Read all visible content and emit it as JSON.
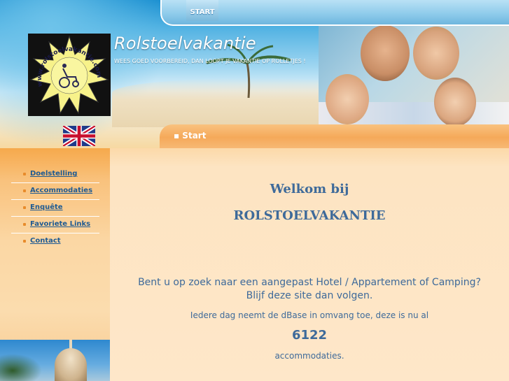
{
  "topnav": {
    "tabs": [
      {
        "label": "START"
      }
    ]
  },
  "header": {
    "logo_text": "www.rolstoelvakantie.com",
    "site_title": "Rolstoelvakantie",
    "tagline": "WEES GOED VOORBEREID, DAN LOOPT JE VAKANTIE OP ROLLETJES !",
    "language_flag": "uk-flag-icon"
  },
  "breadcrumb": {
    "label": "▪ Start"
  },
  "sidebar": {
    "items": [
      {
        "label": "Doelstelling"
      },
      {
        "label": "Accommodaties"
      },
      {
        "label": "Enquête"
      },
      {
        "label": "Favoriete Links"
      },
      {
        "label": "Contact"
      }
    ]
  },
  "main": {
    "welcome": "Welkom bij",
    "site_name": "ROLSTOELVAKANTIE",
    "intro_line1": "Bent u op zoek naar een aangepast Hotel / Appartement of Camping?",
    "intro_line2": "Blijf deze site dan volgen.",
    "growth_text": "Iedere dag neemt de dBase in omvang toe, deze is nu al",
    "count": "6122",
    "count_unit": "accommodaties."
  },
  "colors": {
    "link": "#1e5a92",
    "heading": "#3e6a9a",
    "accent_orange": "#f5a95a",
    "sky_blue": "#8ccaea"
  }
}
